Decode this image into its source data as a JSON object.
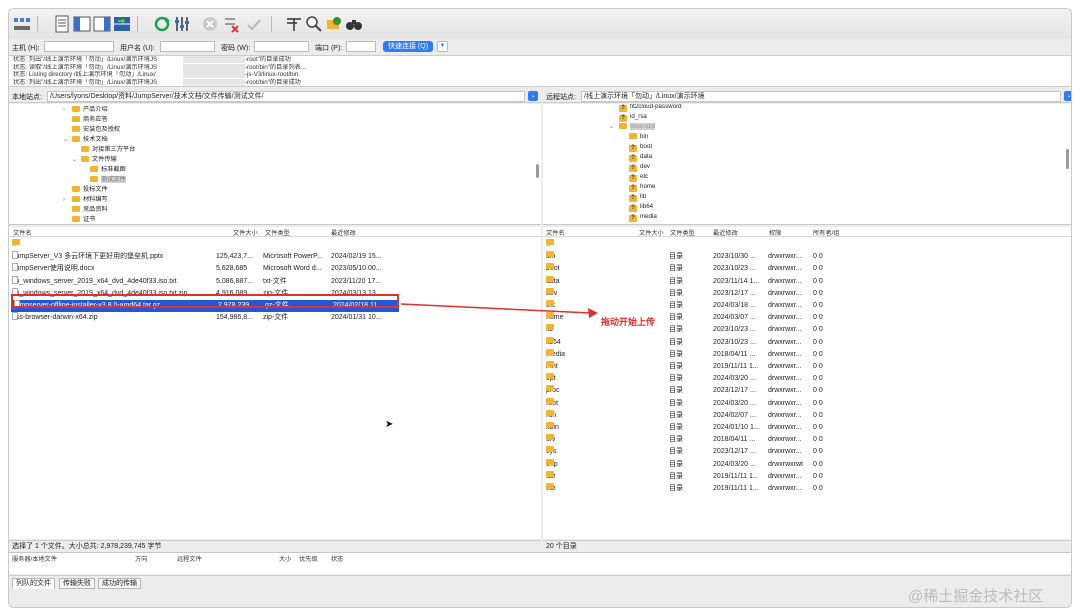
{
  "quickconnect": {
    "host_label": "主机 (H):",
    "user_label": "用户名 (U):",
    "pass_label": "密码 (W):",
    "port_label": "端口 (P):",
    "button": "快速连接 (Q)",
    "host_value": "",
    "user_value": "",
    "pass_value": "",
    "port_value": ""
  },
  "log": [
    {
      "a": "状态: 列出\"/线上演示环境「勿动」/Linux/演示环境JS",
      "b": "-root\"的目录成功"
    },
    {
      "a": "状态: 读取\"/线上演示环境「勿动」/Linux/演示环境JS",
      "b": "-root/bin\"的目录列表..."
    },
    {
      "a": "状态: Listing directory /线上演示环境「勿动」/Linux/",
      "b": "-js-V3/linux-root/bin"
    },
    {
      "a": "状态: 列出\"/线上演示环境「勿动」/Linux/演示环境JS",
      "b": "-root/bin\"的目录成功"
    }
  ],
  "local": {
    "site_label": "本地站点:",
    "path": "/Users/lyons/Desktop/资料/JumpServer/技术文档/文件传输/测试文件/",
    "tree": [
      {
        "name": "产品介绍",
        "level": 2,
        "arrow": "›"
      },
      {
        "name": "商务应答",
        "level": 2,
        "arrow": ""
      },
      {
        "name": "安装包及授权",
        "level": 2,
        "arrow": ""
      },
      {
        "name": "技术文档",
        "level": 2,
        "arrow": "⌄"
      },
      {
        "name": "对接第三方平台",
        "level": 3,
        "arrow": ""
      },
      {
        "name": "文件传输",
        "level": 3,
        "arrow": "⌄"
      },
      {
        "name": "标准截图",
        "level": 4,
        "arrow": ""
      },
      {
        "name": "测试文件",
        "level": 4,
        "arrow": "",
        "selected": true
      },
      {
        "name": "投标文件",
        "level": 2,
        "arrow": ""
      },
      {
        "name": "材料编写",
        "level": 2,
        "arrow": "›"
      },
      {
        "name": "竞品资料",
        "level": 2,
        "arrow": ""
      },
      {
        "name": "证书",
        "level": 2,
        "arrow": ""
      }
    ],
    "headers": {
      "name": "文件名",
      "size": "文件大小",
      "type": "文件类型",
      "modified": "最近修改"
    },
    "files": [
      {
        "name": "..",
        "size": "",
        "type": "",
        "modified": "",
        "kind": "folder"
      },
      {
        "name": "JumpServer_V3 多云环境下更好用的堡垒机.pptx",
        "size": "125,423,7...",
        "type": "Microsoft PowerP...",
        "modified": "2024/02/19 15...",
        "kind": "doc"
      },
      {
        "name": "JumpServer使用说明.docx",
        "size": "5,628,685",
        "type": "Microsoft Word d...",
        "modified": "2023/05/10 00...",
        "kind": "doc"
      },
      {
        "name": "cn_windows_server_2019_x64_dvd_4de40f33.iso.txt",
        "size": "5,086,887...",
        "type": "txt-文件",
        "modified": "2023/11/20 17...",
        "kind": "doc"
      },
      {
        "name": "cn_windows_server_2019_x64_dvd_4de40f33.iso.txt.zip",
        "size": "4,916,089...",
        "type": "zip-文件",
        "modified": "2024/03/13 13...",
        "kind": "doc"
      },
      {
        "name": "jumpserver-offline-installer-v3.8.0-amd64.tar.gz",
        "size": "2,978,239...",
        "type": "gz-文件",
        "modified": "2024/02/18 11...",
        "kind": "doc",
        "selected": true
      },
      {
        "name": "oss-browser-darwin-x64.zip",
        "size": "154,986,8...",
        "type": "zip-文件",
        "modified": "2024/01/31 10...",
        "kind": "doc"
      }
    ],
    "status": "选择了 1 个文件。大小总共: 2,978,239,745 字节"
  },
  "remote": {
    "site_label": "远程站点:",
    "path": "/线上演示环境「勿动」/Linux/演示环境",
    "tree": [
      {
        "name": "fit2cloud-password",
        "level": 0,
        "icon": "q"
      },
      {
        "name": "id_rsa",
        "level": 0,
        "icon": "q"
      },
      {
        "name": "linux-root",
        "level": 0,
        "icon": "folder",
        "arrow": "⌄",
        "selected": true
      },
      {
        "name": "bin",
        "level": 1,
        "icon": "folder"
      },
      {
        "name": "boot",
        "level": 1,
        "icon": "q"
      },
      {
        "name": "data",
        "level": 1,
        "icon": "q"
      },
      {
        "name": "dev",
        "level": 1,
        "icon": "q"
      },
      {
        "name": "etc",
        "level": 1,
        "icon": "q"
      },
      {
        "name": "home",
        "level": 1,
        "icon": "q"
      },
      {
        "name": "lib",
        "level": 1,
        "icon": "q"
      },
      {
        "name": "lib64",
        "level": 1,
        "icon": "q"
      },
      {
        "name": "media",
        "level": 1,
        "icon": "q"
      }
    ],
    "headers": {
      "name": "文件名",
      "size": "文件大小",
      "type": "文件类型",
      "modified": "最近修改",
      "perm": "权限",
      "owner": "所有者/组"
    },
    "files": [
      {
        "name": "..",
        "type": "",
        "modified": "",
        "perm": "",
        "owner": ""
      },
      {
        "name": "bin",
        "type": "目录",
        "modified": "2023/10/30 ...",
        "perm": "drwxrwxr...",
        "owner": "0 0"
      },
      {
        "name": "boot",
        "type": "目录",
        "modified": "2023/10/23 ...",
        "perm": "drwxrwxr...",
        "owner": "0 0"
      },
      {
        "name": "data",
        "type": "目录",
        "modified": "2023/11/14 1...",
        "perm": "drwxrwxr...",
        "owner": "0 0"
      },
      {
        "name": "dev",
        "type": "目录",
        "modified": "2023/12/17 ...",
        "perm": "drwxrwxr...",
        "owner": "0 0"
      },
      {
        "name": "etc",
        "type": "目录",
        "modified": "2024/03/18 ...",
        "perm": "drwxrwxr...",
        "owner": "0 0"
      },
      {
        "name": "home",
        "type": "目录",
        "modified": "2024/03/07 ...",
        "perm": "drwxrwxr...",
        "owner": "0 0"
      },
      {
        "name": "lib",
        "type": "目录",
        "modified": "2023/10/23 ...",
        "perm": "drwxrwxr...",
        "owner": "0 0"
      },
      {
        "name": "lib64",
        "type": "目录",
        "modified": "2023/10/23 ...",
        "perm": "drwxrwxr...",
        "owner": "0 0"
      },
      {
        "name": "media",
        "type": "目录",
        "modified": "2018/04/11 ...",
        "perm": "drwxrwxr...",
        "owner": "0 0"
      },
      {
        "name": "mnt",
        "type": "目录",
        "modified": "2019/11/11 1...",
        "perm": "drwxrwxr...",
        "owner": "0 0"
      },
      {
        "name": "opt",
        "type": "目录",
        "modified": "2024/03/20 ...",
        "perm": "drwxrwxr...",
        "owner": "0 0"
      },
      {
        "name": "proc",
        "type": "目录",
        "modified": "2023/12/17 ...",
        "perm": "drwxrwxr...",
        "owner": "0 0"
      },
      {
        "name": "root",
        "type": "目录",
        "modified": "2024/03/20 ...",
        "perm": "drwxrwxr...",
        "owner": "0 0"
      },
      {
        "name": "run",
        "type": "目录",
        "modified": "2024/02/07 ...",
        "perm": "drwxrwxr...",
        "owner": "0 0"
      },
      {
        "name": "sbin",
        "type": "目录",
        "modified": "2024/01/10 1...",
        "perm": "drwxrwxr...",
        "owner": "0 0"
      },
      {
        "name": "srv",
        "type": "目录",
        "modified": "2018/04/11 ...",
        "perm": "drwxrwxr...",
        "owner": "0 0"
      },
      {
        "name": "sys",
        "type": "目录",
        "modified": "2023/12/17 ...",
        "perm": "drwxrwxr...",
        "owner": "0 0"
      },
      {
        "name": "tmp",
        "type": "目录",
        "modified": "2024/03/20 ...",
        "perm": "drwxrwxrwt",
        "owner": "0 0"
      },
      {
        "name": "usr",
        "type": "目录",
        "modified": "2019/11/11 1...",
        "perm": "drwxrwxr...",
        "owner": "0 0"
      },
      {
        "name": "var",
        "type": "目录",
        "modified": "2019/11/11 1...",
        "perm": "drwxrwxr...",
        "owner": "0 0"
      }
    ],
    "status": "20 个目录"
  },
  "queue": {
    "headers": [
      "服务器/本地文件",
      "方向",
      "远程文件",
      "大小",
      "优先级",
      "状态"
    ]
  },
  "tabs": [
    "列队的文件",
    "传输失败",
    "成功的传输"
  ],
  "annotation": "拖动开始上传",
  "watermark": "@稀土掘金技术社区",
  "colors": {
    "accent": "#2f7cf6",
    "selection": "#2357d6",
    "annotation": "#e03030",
    "folder": "#f2b530"
  }
}
